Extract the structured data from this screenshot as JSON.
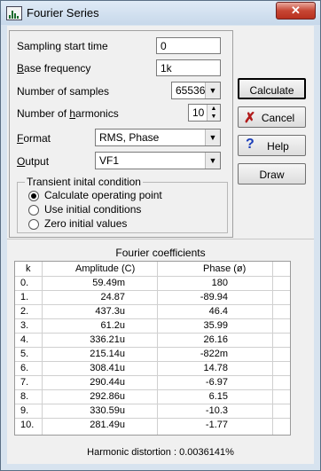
{
  "window": {
    "title": "Fourier Series",
    "close_glyph": "✕"
  },
  "form": {
    "sampling_start_time": {
      "label": "Sampling start time",
      "value": "0"
    },
    "base_frequency": {
      "label_u": "B",
      "label_rest": "ase frequency",
      "value": "1k"
    },
    "number_of_samples": {
      "label": "Number of samples",
      "value": "65536"
    },
    "number_of_harmonics": {
      "label_a": "Number of ",
      "label_u": "h",
      "label_b": "armonics",
      "value": "10"
    },
    "format": {
      "label_u": "F",
      "label_rest": "ormat",
      "value": "RMS, Phase"
    },
    "output": {
      "label_u": "O",
      "label_rest": "utput",
      "value": "VF1"
    }
  },
  "transient": {
    "legend": "Transient inital condition",
    "options": [
      "Calculate operating point",
      "Use initial conditions",
      "Zero initial values"
    ],
    "selected_index": 0
  },
  "buttons": {
    "calculate": "Calculate",
    "cancel": "Cancel",
    "help": "Help",
    "draw": "Draw"
  },
  "coefficients": {
    "title": "Fourier coefficients",
    "headers": {
      "k": "k",
      "amplitude": "Amplitude (C)",
      "phase": "Phase (ø)"
    },
    "rows": [
      {
        "k": "0.",
        "amplitude": "59.49m",
        "phase": "180"
      },
      {
        "k": "1.",
        "amplitude": "24.87",
        "phase": "-89.94"
      },
      {
        "k": "2.",
        "amplitude": "437.3u",
        "phase": "46.4"
      },
      {
        "k": "3.",
        "amplitude": "61.2u",
        "phase": "35.99"
      },
      {
        "k": "4.",
        "amplitude": "336.21u",
        "phase": "26.16"
      },
      {
        "k": "5.",
        "amplitude": "215.14u",
        "phase": "-822m"
      },
      {
        "k": "6.",
        "amplitude": "308.41u",
        "phase": "14.78"
      },
      {
        "k": "7.",
        "amplitude": "290.44u",
        "phase": "-6.97"
      },
      {
        "k": "8.",
        "amplitude": "292.86u",
        "phase": "6.15"
      },
      {
        "k": "9.",
        "amplitude": "330.59u",
        "phase": "-10.3"
      },
      {
        "k": "10.",
        "amplitude": "281.49u",
        "phase": "-1.77"
      }
    ]
  },
  "distortion": {
    "label": "Harmonic distortion :",
    "value": "0.0036141%"
  },
  "icons": {
    "app": "fourier-app-icon",
    "cancel": "x-icon",
    "help": "question-icon"
  }
}
